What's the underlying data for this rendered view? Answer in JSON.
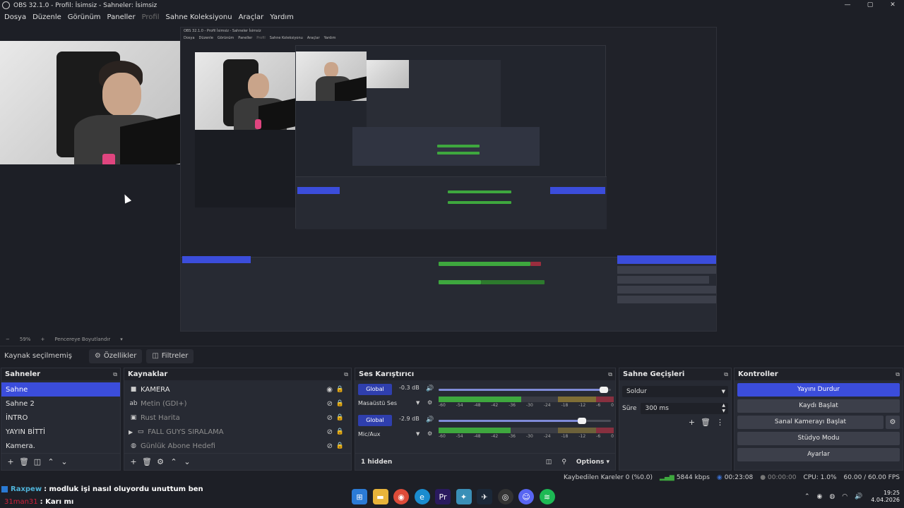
{
  "window": {
    "title": "OBS 32.1.0 - Profil: İsimsiz - Sahneler: İsimsiz",
    "controls": [
      "—",
      "▢",
      "✕"
    ]
  },
  "menu": {
    "items": [
      "Dosya",
      "Düzenle",
      "Görünüm",
      "Paneller",
      "Profil",
      "Sahne Koleksiyonu",
      "Araçlar",
      "Yardım"
    ]
  },
  "nested": {
    "title": "OBS 32.1.0 - Profil İsimsiz - Sahneler İsimsiz",
    "menu": [
      "Dosya",
      "Düzenle",
      "Görünüm",
      "Paneller",
      "Profil",
      "Sahne Koleksiyonu",
      "Araçlar",
      "Yardım"
    ]
  },
  "zoom": {
    "minus": "−",
    "value": "59%",
    "plus": "+",
    "mode": "Pencereye Boyutlandır",
    "caret": "▾"
  },
  "source_toolbar": {
    "label": "Kaynak seçilmemiş",
    "properties": "Özellikler",
    "filters": "Filtreler"
  },
  "scenes": {
    "title": "Sahneler",
    "items": [
      "Sahne",
      "Sahne 2",
      "İNTRO",
      "YAYIN BİTTİ",
      "Kamera."
    ],
    "selected": 0
  },
  "sources": {
    "title": "Kaynaklar",
    "items": [
      {
        "name": "KAMERA",
        "icon": "camera-icon",
        "dim": false,
        "folder": false
      },
      {
        "name": "Metin (GDI+)",
        "icon": "text-icon",
        "dim": true,
        "folder": false
      },
      {
        "name": "Rust Harita",
        "icon": "image-icon",
        "dim": true,
        "folder": false
      },
      {
        "name": "FALL GUYS SIRALAMA",
        "icon": "folder-icon",
        "dim": true,
        "folder": true
      },
      {
        "name": "Günlük Abone Hedefi",
        "icon": "globe-icon",
        "dim": true,
        "folder": false
      }
    ]
  },
  "mixer": {
    "title": "Ses Karıştırıcı",
    "channels": [
      {
        "name": "Masaüstü Ses",
        "global": "Global",
        "db": "-0.3 dB",
        "level": 0.96,
        "meter": 0.47
      },
      {
        "name": "Mic/Aux",
        "global": "Global",
        "db": "-2.9 dB",
        "level": 0.83,
        "meter": 0.41
      }
    ],
    "ticks": [
      "-60",
      "-54",
      "-48",
      "-42",
      "-36",
      "-30",
      "-24",
      "-18",
      "-12",
      "-6",
      "0"
    ],
    "hidden": "1 hidden",
    "options": "Options"
  },
  "transitions": {
    "title": "Sahne Geçişleri",
    "selected": "Soldur",
    "duration_label": "Süre",
    "duration": "300 ms"
  },
  "controls": {
    "title": "Kontroller",
    "stream": "Yayını Durdur",
    "record": "Kaydı Başlat",
    "virtualcam": "Sanal Kamerayı Başlat",
    "studio": "Stüdyo Modu",
    "settings": "Ayarlar"
  },
  "status": {
    "dropped": "Kaybedilen Kareler 0 (%0.0)",
    "bitrate": "5844 kbps",
    "stream_time": "00:23:08",
    "rec_time": "00:00:00",
    "cpu": "CPU: 1.0%",
    "fps": "60.00 / 60.00 FPS"
  },
  "chat": [
    {
      "user": "Raxpew",
      "message": ": modluk işi nasıl oluyordu unuttum ben",
      "color": "#4fb3d9"
    },
    {
      "user": "31man31",
      "message": ": Karı mı",
      "color": "#d0213b"
    }
  ],
  "taskbar": {
    "time": "19:25",
    "date": "4.04.2026"
  },
  "colors": {
    "accent": "#3b4ddb",
    "panel": "#272a33",
    "background": "#1d1f26"
  }
}
